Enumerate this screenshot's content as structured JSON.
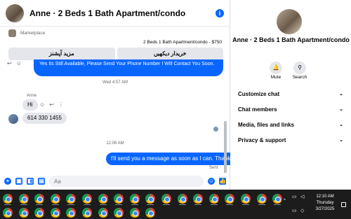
{
  "chat": {
    "title": "Anne · 2 Beds 1 Bath Apartment/condo",
    "info_icon": "info-icon",
    "marketplace_label": "Marketplace",
    "listing": "2 Beds 1 Bath Apartment/condo - $750",
    "buttons": [
      "مزید آپشنز",
      "خریدار دیکھیں"
    ],
    "pinned_text": "Yes Its Still Available, Please Send Your Phone Number I Will Contact You Soon.",
    "timestamps": [
      "Wed 4:57 AM",
      "12:08 AM"
    ],
    "sender_name": "Anne",
    "incoming": [
      "Hi",
      "614 330 1455"
    ],
    "outgoing": "I'll send you a message as soon as I can. Thanks",
    "sent_label": "Sent",
    "input_placeholder": "Aa",
    "accent_color": "#0866ff"
  },
  "info_panel": {
    "name": "Anne · 2 Beds 1 Bath Apartment/condo",
    "actions": [
      {
        "label": "Mute",
        "icon": "bell-icon"
      },
      {
        "label": "Search",
        "icon": "search-icon"
      }
    ],
    "sections": [
      "Customize chat",
      "Chat members",
      "Media, files and links",
      "Privacy & support"
    ]
  },
  "taskbar": {
    "time": "12:10 AM",
    "day": "Thursday",
    "date": "3/27/2025",
    "app_icon_count": 28
  }
}
